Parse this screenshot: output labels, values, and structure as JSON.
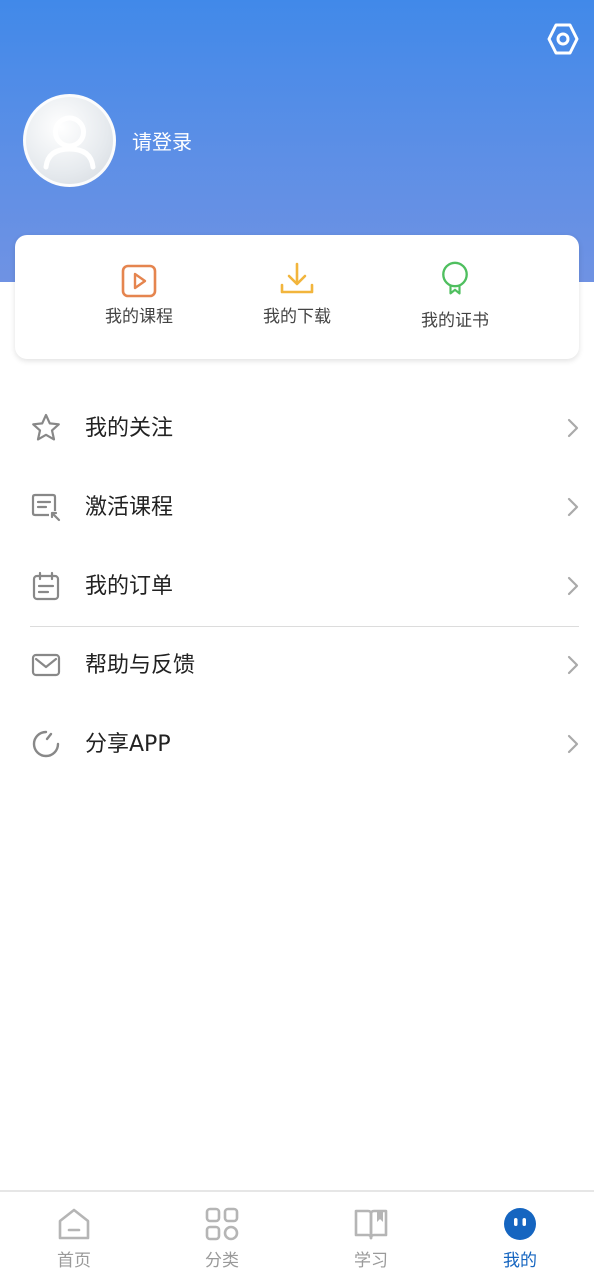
{
  "header": {
    "login_prompt": "请登录",
    "settings_icon": "hexagon-settings-icon",
    "avatar_icon": "default-user-avatar"
  },
  "quick_actions": [
    {
      "label": "我的课程",
      "icon": "play-video-icon",
      "color": "#e5854f"
    },
    {
      "label": "我的下载",
      "icon": "download-icon",
      "color": "#f2b53c"
    },
    {
      "label": "我的证书",
      "icon": "certificate-badge-icon",
      "color": "#4fbf5f"
    }
  ],
  "menu": {
    "items": [
      {
        "label": "我的关注",
        "icon": "star-icon"
      },
      {
        "label": "激活课程",
        "icon": "activate-card-icon"
      },
      {
        "label": "我的订单",
        "icon": "calendar-order-icon"
      },
      {
        "label": "帮助与反馈",
        "icon": "mail-feedback-icon"
      },
      {
        "label": "分享APP",
        "icon": "share-refresh-icon"
      }
    ]
  },
  "tabbar": {
    "tabs": [
      {
        "label": "首页",
        "icon": "home-icon",
        "active": false
      },
      {
        "label": "分类",
        "icon": "category-grid-icon",
        "active": false
      },
      {
        "label": "学习",
        "icon": "open-book-icon",
        "active": false
      },
      {
        "label": "我的",
        "icon": "profile-face-icon",
        "active": true
      }
    ],
    "active_color": "#1565c0",
    "inactive_color": "#9a9a9a"
  },
  "colors": {
    "header_top": "#4189e9",
    "header_bottom": "#6f92e3",
    "divider": "#dcdcdc"
  }
}
